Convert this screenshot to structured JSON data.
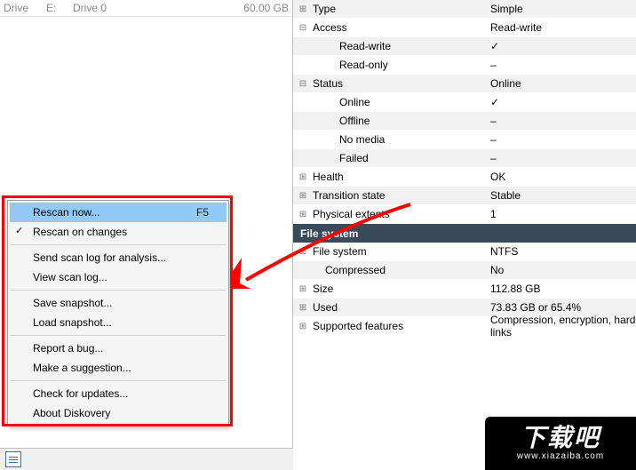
{
  "left": {
    "disk": {
      "label": "Drive",
      "letter": "E:",
      "drive": "Drive 0",
      "size": "60.00 GB"
    }
  },
  "menu": {
    "rescan_now": "Rescan now...",
    "rescan_now_shortcut": "F5",
    "rescan_on_changes": "Rescan on changes",
    "send_scan_log": "Send scan log for analysis...",
    "view_scan_log": "View scan log...",
    "save_snapshot": "Save snapshot...",
    "load_snapshot": "Load snapshot...",
    "report_bug": "Report a bug...",
    "make_suggestion": "Make a suggestion...",
    "check_updates": "Check for updates...",
    "about": "About Diskovery"
  },
  "props": {
    "type": {
      "label": "Type",
      "value": "Simple"
    },
    "access": {
      "label": "Access",
      "value": "Read-write"
    },
    "access_rw": {
      "label": "Read-write",
      "value": "✓"
    },
    "access_ro": {
      "label": "Read-only",
      "value": "–"
    },
    "status": {
      "label": "Status",
      "value": "Online"
    },
    "status_online": {
      "label": "Online",
      "value": "✓"
    },
    "status_offline": {
      "label": "Offline",
      "value": "–"
    },
    "status_nomedia": {
      "label": "No media",
      "value": "–"
    },
    "status_failed": {
      "label": "Failed",
      "value": "–"
    },
    "health": {
      "label": "Health",
      "value": "OK"
    },
    "transition": {
      "label": "Transition state",
      "value": "Stable"
    },
    "extents": {
      "label": "Physical extents",
      "value": "1"
    },
    "fs_section": "File system",
    "fs": {
      "label": "File system",
      "value": "NTFS"
    },
    "compressed": {
      "label": "Compressed",
      "value": "No"
    },
    "size": {
      "label": "Size",
      "value": "112.88 GB"
    },
    "used": {
      "label": "Used",
      "value": "73.83 GB  or  65.4%"
    },
    "features": {
      "label": "Supported features",
      "value": "Compression, encryption, hard links"
    }
  },
  "watermark": {
    "cn": "下载吧",
    "url": "www.xiazaiba.com"
  }
}
